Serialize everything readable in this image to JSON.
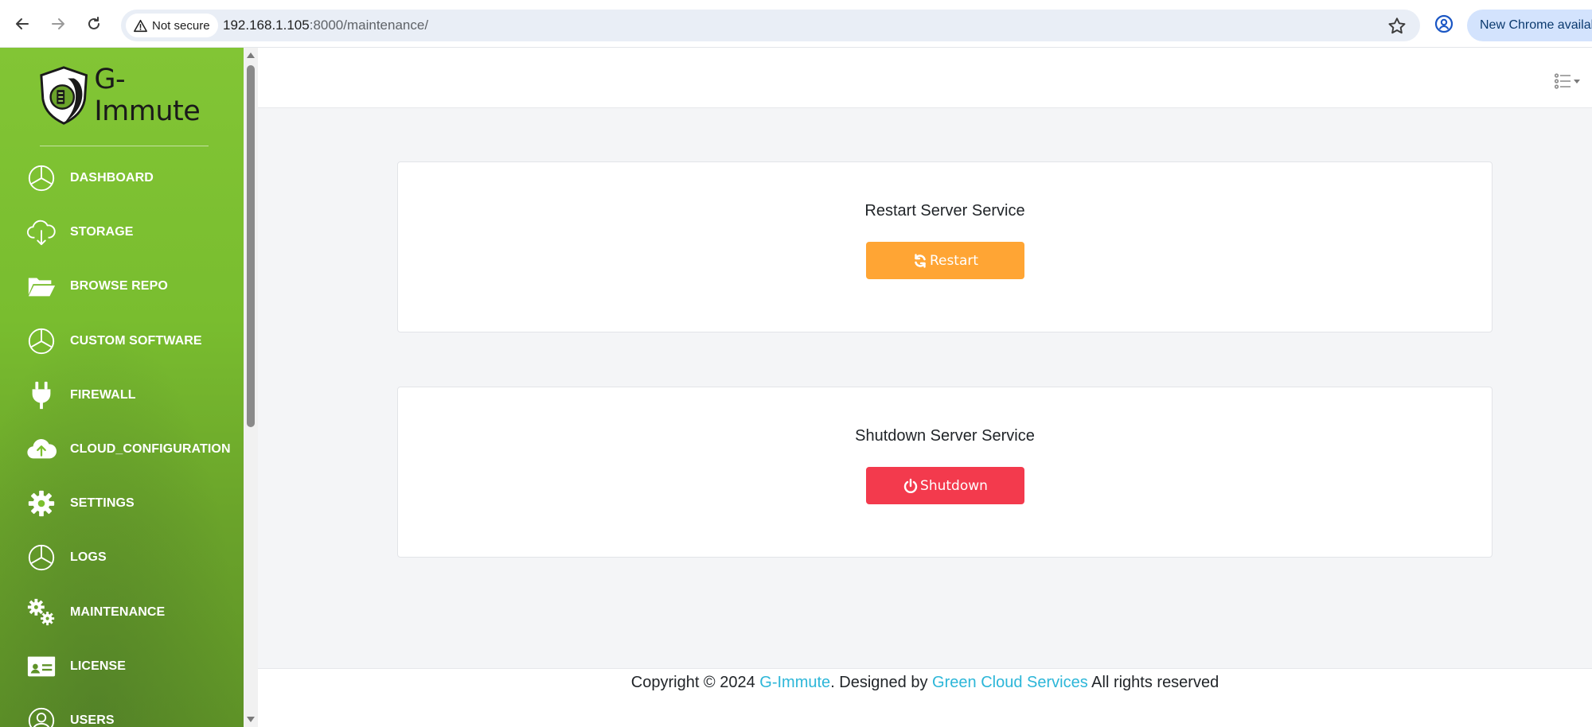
{
  "browser": {
    "security_label": "Not secure",
    "url_host": "192.168.1.105",
    "url_rest": ":8000/maintenance/",
    "update_pill": "New Chrome available"
  },
  "sidebar": {
    "brand": "G-Immute",
    "items": [
      {
        "label": "DASHBOARD",
        "icon": "pie-chart-icon"
      },
      {
        "label": "STORAGE",
        "icon": "cloud-download-icon"
      },
      {
        "label": "BROWSE REPO",
        "icon": "folder-open-icon"
      },
      {
        "label": "CUSTOM SOFTWARE",
        "icon": "pie-chart-icon"
      },
      {
        "label": "FIREWALL",
        "icon": "plug-icon"
      },
      {
        "label": "CLOUD_CONFIGURATION",
        "icon": "cloud-upload-icon"
      },
      {
        "label": "SETTINGS",
        "icon": "gear-icon"
      },
      {
        "label": "LOGS",
        "icon": "pie-chart-icon"
      },
      {
        "label": "MAINTENANCE",
        "icon": "gears-icon"
      },
      {
        "label": "LICENSE",
        "icon": "id-card-icon"
      },
      {
        "label": "USERS",
        "icon": "user-circle-icon"
      }
    ]
  },
  "main": {
    "restart_card": {
      "title": "Restart Server Service",
      "button": "Restart"
    },
    "shutdown_card": {
      "title": "Shutdown Server Service",
      "button": "Shutdown"
    }
  },
  "footer": {
    "prefix": "Copyright © 2024 ",
    "brand_link": "G-Immute",
    "middle": ". Designed by ",
    "company_link": "Green Cloud Services",
    "suffix": " All rights reserved"
  },
  "colors": {
    "sidebar_green": "#7cc02f",
    "restart_orange": "#ffa534",
    "shutdown_red": "#f33a4d",
    "footer_link": "#2cb6d8"
  }
}
